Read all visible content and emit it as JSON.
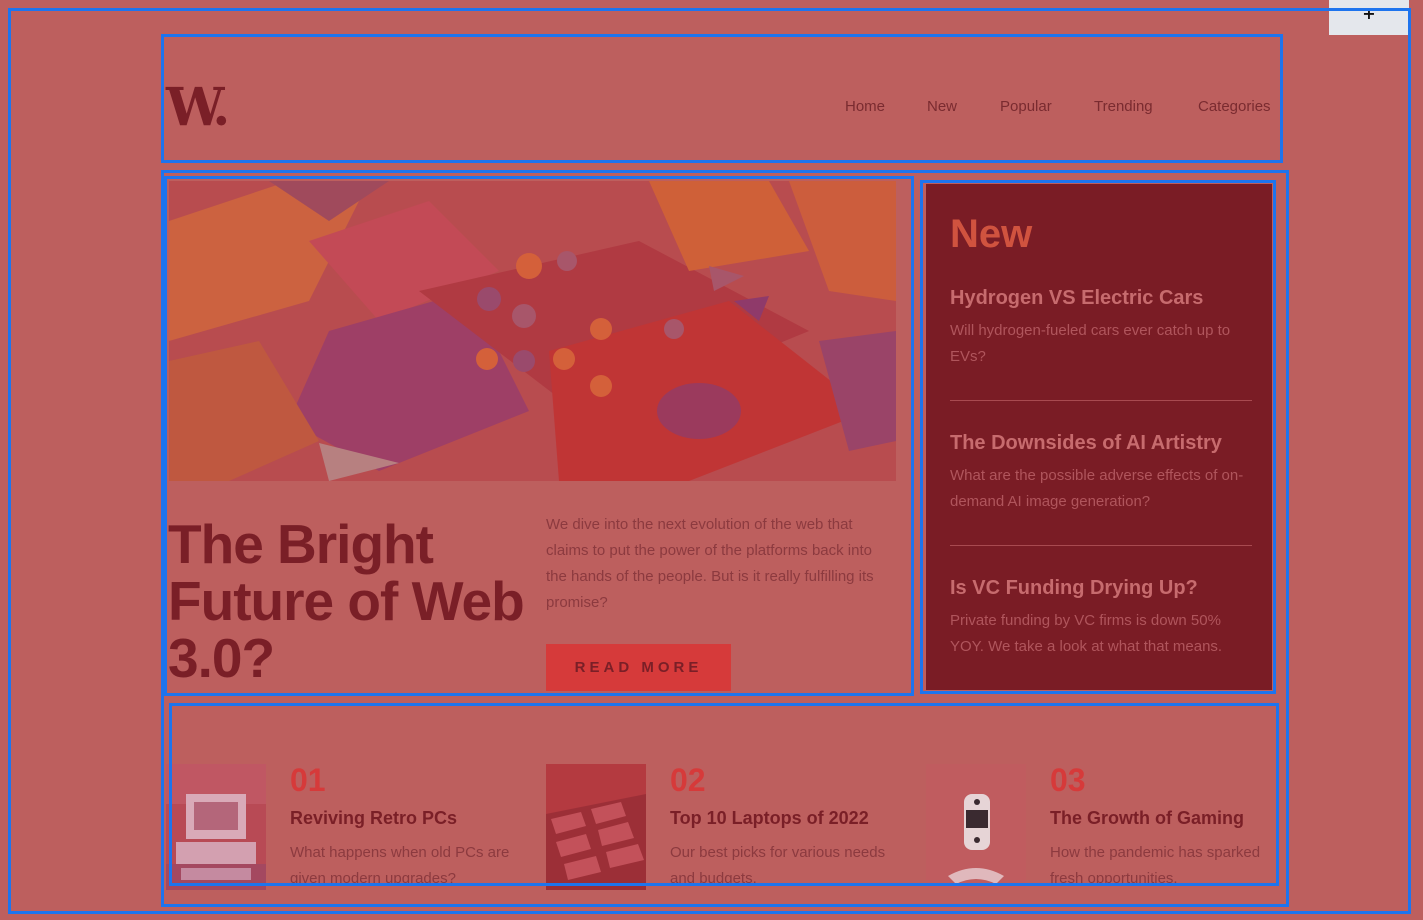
{
  "header": {
    "logo": "W.",
    "nav": [
      "Home",
      "New",
      "Popular",
      "Trending",
      "Categories"
    ]
  },
  "hero": {
    "title": "The Bright Future of Web 3.0?",
    "description": "We dive into the next evolution of the web that claims to put the power of the platforms back into the hands of the people. But is it really fulfilling its promise?",
    "button": "READ MORE"
  },
  "new_panel": {
    "heading": "New",
    "items": [
      {
        "title": "Hydrogen VS Electric Cars",
        "desc": "Will hydrogen-fueled cars ever catch up to EVs?"
      },
      {
        "title": "The Downsides of AI Artistry",
        "desc": "What are the possible adverse effects of on-demand AI image generation?"
      },
      {
        "title": "Is VC Funding Drying Up?",
        "desc": "Private funding by VC firms is down 50% YOY. We take a look at what that means."
      }
    ]
  },
  "cards": [
    {
      "num": "01",
      "title": "Reviving Retro PCs",
      "desc": "What happens when old PCs are given modern upgrades?"
    },
    {
      "num": "02",
      "title": "Top 10 Laptops of 2022",
      "desc": "Our best picks for various needs and budgets."
    },
    {
      "num": "03",
      "title": "The Growth of Gaming",
      "desc": "How the pandemic has sparked fresh opportunities."
    }
  ],
  "overlay": {
    "corner_marker": "+",
    "outline_color": "#1d74ee",
    "tint_color": "#bd5f5e"
  }
}
